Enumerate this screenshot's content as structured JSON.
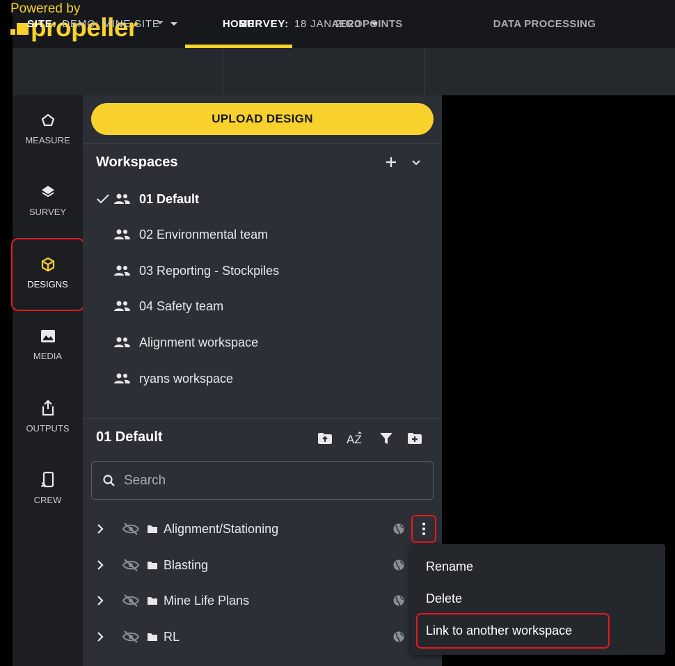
{
  "branding": {
    "powered_by": "Powered by",
    "logo_text": "propeller"
  },
  "nav": {
    "tabs": [
      {
        "label": "HOME",
        "active": true
      },
      {
        "label": "AEROPOINTS",
        "active": false
      },
      {
        "label": "DATA PROCESSING",
        "active": false
      }
    ]
  },
  "subnav": {
    "site_label": "SITE:",
    "site_value": "DEMO: MINE SITE",
    "survey_label": "SURVEY:",
    "survey_value": "18 JAN 2020"
  },
  "rail": {
    "items": [
      {
        "label": "MEASURE",
        "icon": "pentagon-icon"
      },
      {
        "label": "SURVEY",
        "icon": "layers-icon"
      },
      {
        "label": "DESIGNS",
        "icon": "cube-icon",
        "active": true
      },
      {
        "label": "MEDIA",
        "icon": "image-icon"
      },
      {
        "label": "OUTPUTS",
        "icon": "share-upload-icon"
      },
      {
        "label": "CREW",
        "icon": "cast-icon"
      }
    ]
  },
  "panel": {
    "upload_label": "UPLOAD DESIGN",
    "workspaces_title": "Workspaces",
    "workspaces": [
      {
        "name": "01 Default",
        "selected": true
      },
      {
        "name": "02 Environmental team"
      },
      {
        "name": "03 Reporting - Stockpiles"
      },
      {
        "name": "04 Safety team"
      },
      {
        "name": "Alignment workspace"
      },
      {
        "name": "ryans workspace"
      }
    ],
    "current_workspace": "01 Default",
    "search_placeholder": "Search",
    "folders": [
      {
        "name": "Alignment/Stationing"
      },
      {
        "name": "Blasting"
      },
      {
        "name": "Mine Life Plans"
      },
      {
        "name": "RL"
      }
    ]
  },
  "context_menu": {
    "items": [
      "Rename",
      "Delete",
      "Link to another workspace"
    ],
    "highlighted": "Link to another workspace"
  },
  "colors": {
    "accent": "#f8d12c",
    "highlight_red": "#e5191f",
    "panel_bg": "#2c3036",
    "rail_bg": "#1c1e22"
  }
}
